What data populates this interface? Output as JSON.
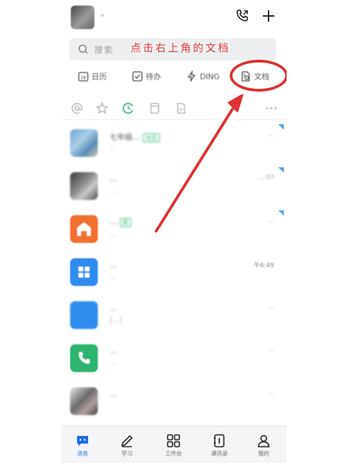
{
  "header": {
    "user_name": "•",
    "call_icon": "phone-call-icon",
    "plus_icon": "plus-icon"
  },
  "search": {
    "placeholder": "搜索",
    "annotation": "点击右上角的文档"
  },
  "shortcuts": [
    {
      "icon": "calendar-icon",
      "label": "日历"
    },
    {
      "icon": "todo-icon",
      "label": "待办"
    },
    {
      "icon": "ding-icon",
      "label": "DING"
    },
    {
      "icon": "document-icon",
      "label": "文档"
    }
  ],
  "filters": [
    "at-icon",
    "star-icon",
    "clock-icon",
    "bookmark-icon",
    "file-icon",
    "more-icon"
  ],
  "messages": [
    {
      "title": "七年级…",
      "tag": "全员",
      "subtitle": "…",
      "time": "…",
      "flag": true
    },
    {
      "title": "…",
      "tag": "",
      "subtitle": "…",
      "time": "…:57",
      "flag": true
    },
    {
      "title": "…",
      "tag": "群",
      "subtitle": "…",
      "time": "…",
      "flag": true
    },
    {
      "title": "…",
      "tag": "",
      "subtitle": "…",
      "time": "午6:49",
      "flag": false
    },
    {
      "title": "…",
      "tag": "",
      "subtitle": "[…]",
      "time": "…",
      "flag": false
    },
    {
      "title": "…",
      "tag": "",
      "subtitle": "…",
      "time": "…",
      "flag": false
    },
    {
      "title": "…",
      "tag": "",
      "subtitle": "",
      "time": "…",
      "flag": false
    }
  ],
  "nav": [
    {
      "icon": "message-icon",
      "label": "消息",
      "active": true
    },
    {
      "icon": "pen-icon",
      "label": "学习",
      "active": false
    },
    {
      "icon": "grid-icon",
      "label": "工作台",
      "active": false
    },
    {
      "icon": "contacts-icon",
      "label": "通讯录",
      "active": false
    },
    {
      "icon": "profile-icon",
      "label": "我的",
      "active": false
    }
  ],
  "colors": {
    "annotation_red": "#e03030",
    "active_blue": "#1b6fe8",
    "green": "#2db36f",
    "orange": "#f07030"
  }
}
